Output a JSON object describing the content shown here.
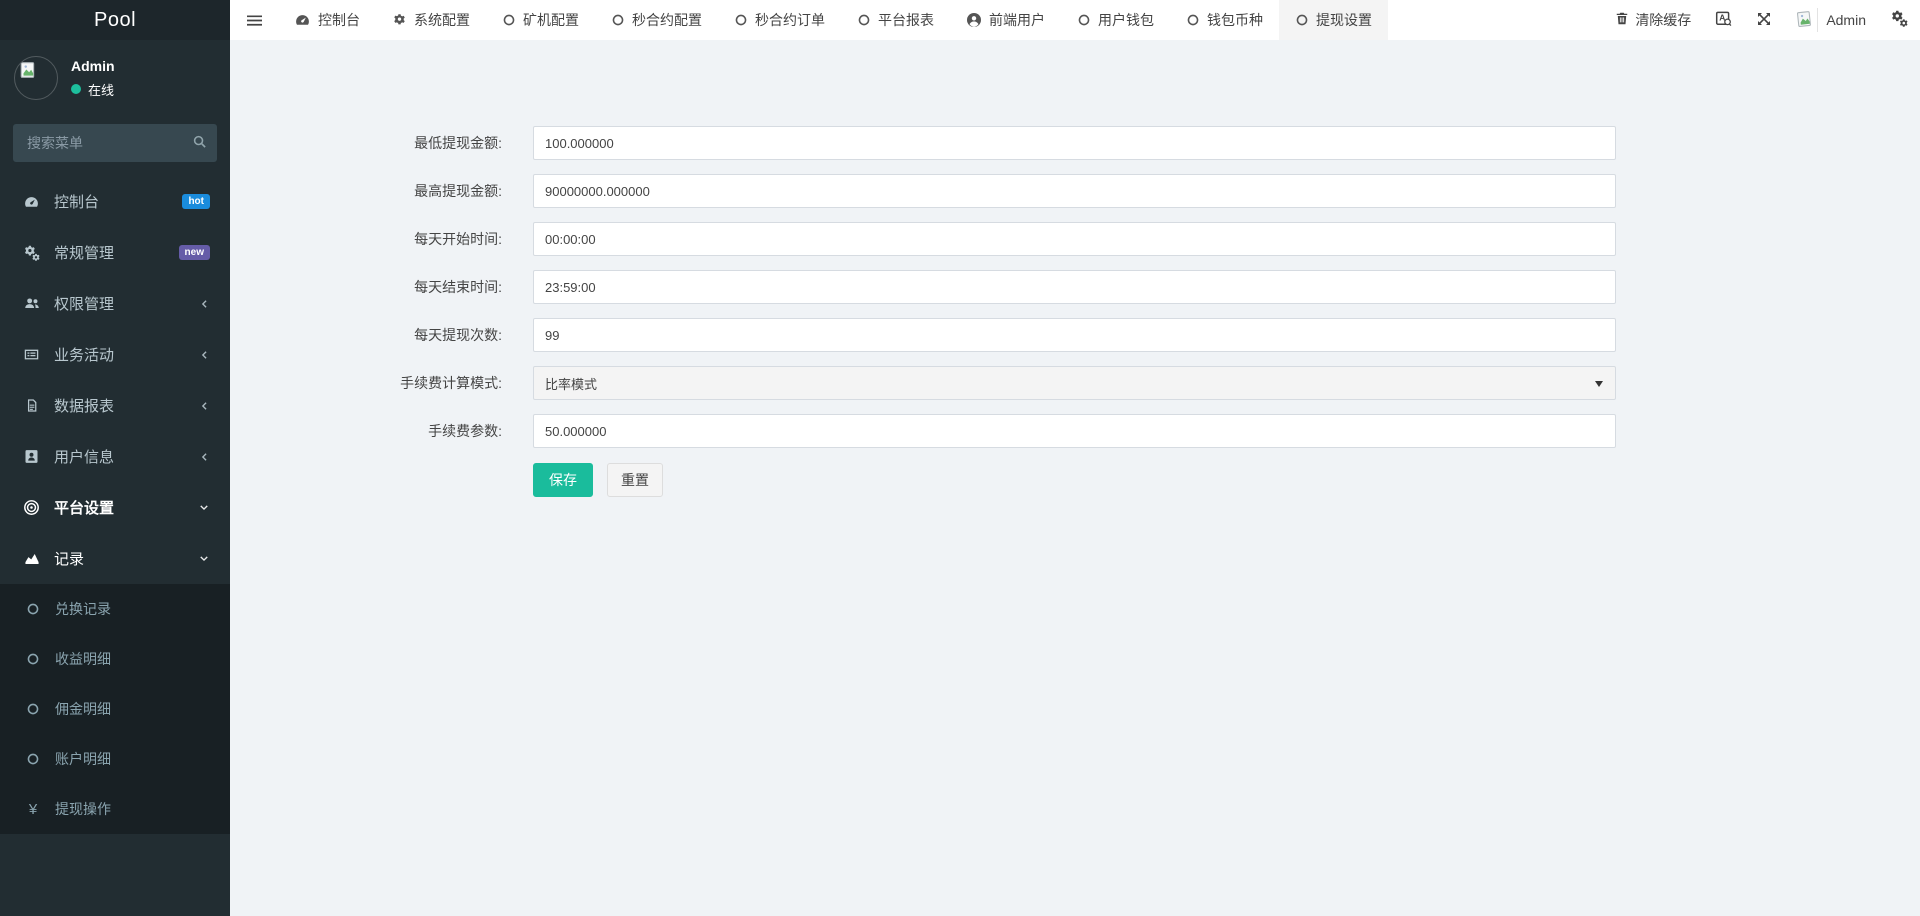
{
  "app": {
    "title": "Pool"
  },
  "sidebar": {
    "user": {
      "name": "Admin",
      "status": "在线"
    },
    "search": {
      "placeholder": "搜索菜单"
    },
    "menu": [
      {
        "key": "dashboard",
        "label": "控制台",
        "icon": "gauge",
        "badge": "hot"
      },
      {
        "key": "general-manage",
        "label": "常规管理",
        "icon": "cogs",
        "badge": "new"
      },
      {
        "key": "permission-manage",
        "label": "权限管理",
        "icon": "users",
        "chevron": "left"
      },
      {
        "key": "business-activity",
        "label": "业务活动",
        "icon": "list",
        "chevron": "left"
      },
      {
        "key": "data-reports",
        "label": "数据报表",
        "icon": "file",
        "chevron": "left"
      },
      {
        "key": "user-info",
        "label": "用户信息",
        "icon": "idcard",
        "chevron": "left"
      },
      {
        "key": "platform-settings",
        "label": "平台设置",
        "icon": "bullseye",
        "chevron": "down",
        "state": "active"
      },
      {
        "key": "records",
        "label": "记录",
        "icon": "chart",
        "chevron": "down",
        "state": "open"
      }
    ],
    "submenu": [
      {
        "key": "exchange-records",
        "label": "兑换记录",
        "icon": "ring"
      },
      {
        "key": "profit-details",
        "label": "收益明细",
        "icon": "ring"
      },
      {
        "key": "commission-details",
        "label": "佣金明细",
        "icon": "ring"
      },
      {
        "key": "account-details",
        "label": "账户明细",
        "icon": "ring"
      },
      {
        "key": "withdraw-actions",
        "label": "提现操作",
        "icon": "yen"
      }
    ]
  },
  "topbar": {
    "tabs": [
      {
        "key": "dashboard",
        "label": "控制台",
        "icon": "gauge"
      },
      {
        "key": "system-config",
        "label": "系统配置",
        "icon": "gear"
      },
      {
        "key": "miner-config",
        "label": "矿机配置",
        "icon": "ring"
      },
      {
        "key": "seconds-contract-config",
        "label": "秒合约配置",
        "icon": "ring"
      },
      {
        "key": "seconds-contract-orders",
        "label": "秒合约订单",
        "icon": "ring"
      },
      {
        "key": "platform-reports",
        "label": "平台报表",
        "icon": "ring"
      },
      {
        "key": "frontend-users",
        "label": "前端用户",
        "icon": "user"
      },
      {
        "key": "user-wallet",
        "label": "用户钱包",
        "icon": "ring"
      },
      {
        "key": "wallet-currency",
        "label": "钱包币种",
        "icon": "ring"
      },
      {
        "key": "withdraw-settings",
        "label": "提现设置",
        "icon": "ring",
        "active": true
      }
    ],
    "clear_cache_label": "清除缓存",
    "user_label": "Admin"
  },
  "form": {
    "fields": [
      {
        "key": "min-withdraw-amount",
        "label": "最低提现金额:",
        "value": "100.000000",
        "type": "input"
      },
      {
        "key": "max-withdraw-amount",
        "label": "最高提现金额:",
        "value": "90000000.000000",
        "type": "input"
      },
      {
        "key": "daily-start-time",
        "label": "每天开始时间:",
        "value": "00:00:00",
        "type": "input"
      },
      {
        "key": "daily-end-time",
        "label": "每天结束时间:",
        "value": "23:59:00",
        "type": "input"
      },
      {
        "key": "daily-withdraw-count",
        "label": "每天提现次数:",
        "value": "99",
        "type": "input"
      },
      {
        "key": "fee-calc-mode",
        "label": "手续费计算模式:",
        "value": "比率模式",
        "type": "select"
      },
      {
        "key": "fee-param",
        "label": "手续费参数:",
        "value": "50.000000",
        "type": "input"
      }
    ],
    "buttons": {
      "save": "保存",
      "reset": "重置"
    }
  },
  "colors": {
    "accent_green": "#1abc9c",
    "badge_hot": "#1a8cdd",
    "badge_new": "#655ca8",
    "online_dot": "#1dbf9d",
    "sidebar_bg": "#222d32",
    "submenu_bg": "#182024",
    "content_bg": "#f0f3f6"
  }
}
